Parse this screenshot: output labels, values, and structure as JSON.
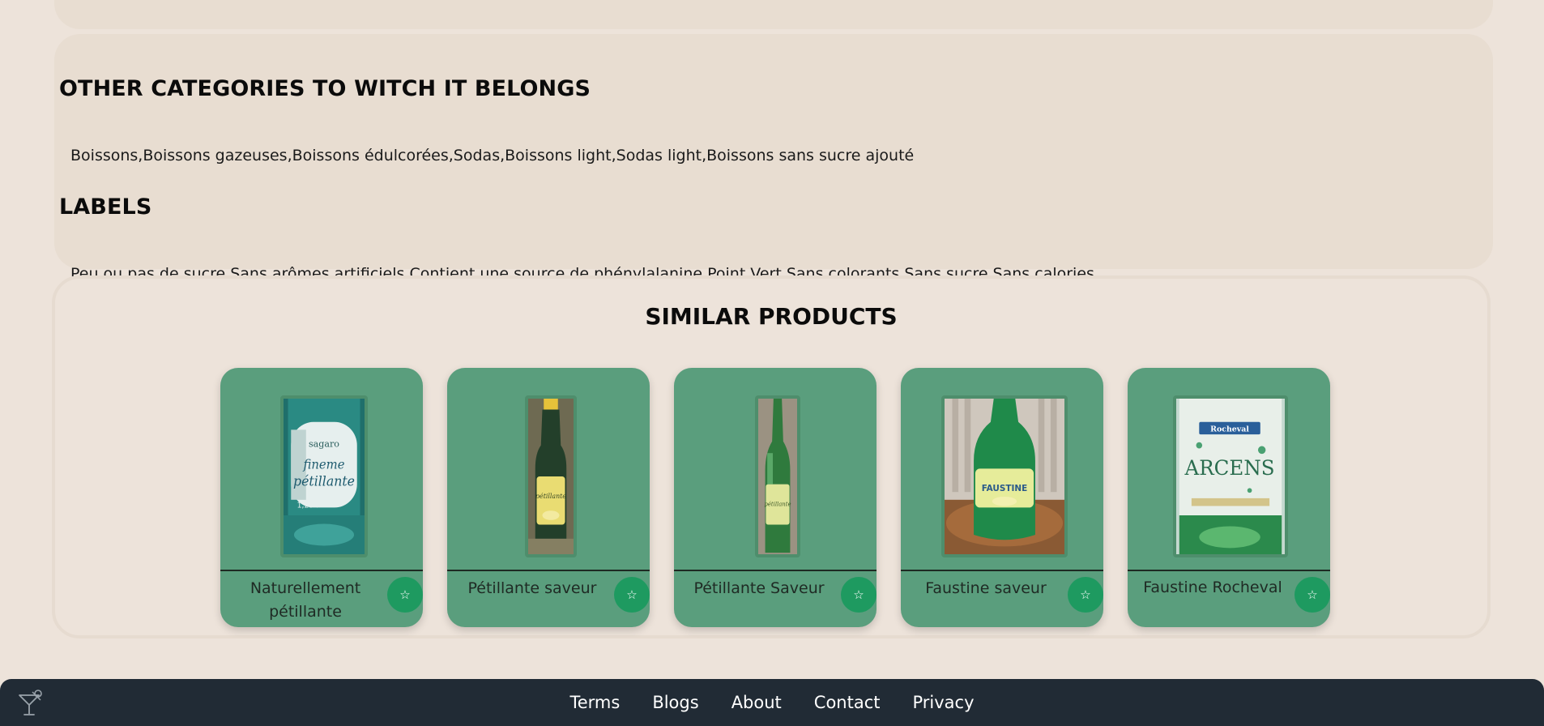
{
  "categories": {
    "title": "OTHER CATEGORIES TO WITCH IT BELONGS",
    "text": "Boissons,Boissons gazeuses,Boissons édulcorées,Sodas,Boissons light,Sodas light,Boissons sans sucre ajouté"
  },
  "labels": {
    "title": "LABELS",
    "text": "Peu ou pas de sucre,Sans arômes artificiels,Contient une source de phénylalanine,Point Vert,Sans colorants,Sans sucre,Sans calories"
  },
  "similar": {
    "title": "SIMILAR PRODUCTS",
    "products": [
      {
        "name": "Naturellement pétillante",
        "favorite_icon": "☆",
        "image_label": "sagaro fineme pétillante 1,25 l"
      },
      {
        "name": "Pétillante saveur",
        "favorite_icon": "☆",
        "image_label": "pétillante"
      },
      {
        "name": "Pétillante Saveur",
        "favorite_icon": "☆",
        "image_label": "pétillante"
      },
      {
        "name": "Faustine saveur",
        "favorite_icon": "☆",
        "image_label": "FAUSTINE"
      },
      {
        "name": "Faustine Rocheval",
        "favorite_icon": "☆",
        "image_label": "Rocheval ARCENS"
      }
    ]
  },
  "footer": {
    "links": [
      "Terms",
      "Blogs",
      "About",
      "Contact",
      "Privacy"
    ],
    "logo_icon": "cocktail-glass-icon"
  },
  "colors": {
    "page_background": "#ede3da",
    "panel_background": "#e8ddd1",
    "card_background": "#5a9e7d",
    "favorite_button": "#1e9a60",
    "footer_background": "#212b35"
  }
}
